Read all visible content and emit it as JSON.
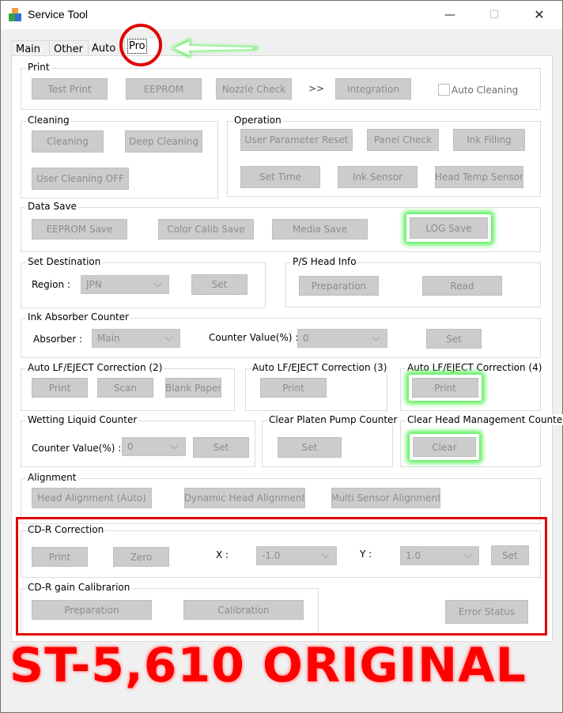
{
  "window": {
    "title": "Service Tool",
    "controls": {
      "minimize": "—",
      "maximize": "☐",
      "close": "✕"
    }
  },
  "tabs": [
    {
      "label": "Main",
      "active": false
    },
    {
      "label": "Other",
      "active": false
    },
    {
      "label": "Auto",
      "active": false
    },
    {
      "label": "Pro",
      "active": true
    }
  ],
  "print": {
    "title": "Print",
    "test_print": "Test Print",
    "eeprom": "EEPROM",
    "nozzle_check": "Nozzle Check",
    "arrow": ">>",
    "integration": "Integration",
    "auto_cleaning": "Auto Cleaning",
    "auto_cleaning_checked": false
  },
  "cleaning": {
    "title": "Cleaning",
    "cleaning": "Cleaning",
    "deep_cleaning": "Deep Cleaning",
    "user_cleaning_off": "User Cleaning OFF"
  },
  "operation": {
    "title": "Operation",
    "user_parameter_reset": "User Parameter Reset",
    "panel_check": "Panel Check",
    "ink_filling": "Ink Filling",
    "set_time": "Set Time",
    "ink_sensor": "Ink Sensor",
    "head_temp_sensor": "Head Temp Sensor"
  },
  "data_save": {
    "title": "Data Save",
    "eeprom_save": "EEPROM Save",
    "color_calib_save": "Color Calib Save",
    "media_save": "Media Save",
    "log_save": "LOG Save"
  },
  "set_destination": {
    "title": "Set Destination",
    "region_label": "Region :",
    "region_value": "JPN",
    "set": "Set"
  },
  "ps_head_info": {
    "title": "P/S Head Info",
    "preparation": "Preparation",
    "read": "Read"
  },
  "ink_absorber": {
    "title": "Ink Absorber Counter",
    "absorber_label": "Absorber :",
    "absorber_value": "Main",
    "counter_label": "Counter Value(%) :",
    "counter_value": "0",
    "set": "Set"
  },
  "auto_lf_2": {
    "title": "Auto LF/EJECT Correction (2)",
    "print": "Print",
    "scan": "Scan",
    "blank_paper": "Blank Paper"
  },
  "auto_lf_3": {
    "title": "Auto LF/EJECT Correction (3)",
    "print": "Print"
  },
  "auto_lf_4": {
    "title": "Auto LF/EJECT Correction (4)",
    "print": "Print"
  },
  "wetting": {
    "title": "Wetting Liquid Counter",
    "counter_label": "Counter Value(%) :",
    "counter_value": "0",
    "set": "Set"
  },
  "platen_pump": {
    "title": "Clear Platen Pump Counter",
    "set": "Set"
  },
  "head_mgmt": {
    "title": "Clear Head Management Counter",
    "clear": "Clear"
  },
  "alignment": {
    "title": "Alignment",
    "head_alignment_auto": "Head Alignment (Auto)",
    "dynamic_head_alignment": "Dynamic Head Alignment",
    "multi_sensor_alignment": "Multi Sensor Alignment"
  },
  "cdr_correction": {
    "title": "CD-R Correction",
    "print": "Print",
    "zero": "Zero",
    "x_label": "X :",
    "x_value": "-1.0",
    "y_label": "Y :",
    "y_value": "1.0",
    "set": "Set"
  },
  "cdr_gain": {
    "title": "CD-R gain Calibrarion",
    "preparation": "Preparation",
    "calibration": "Calibration",
    "error_status": "Error Status"
  },
  "overlay": {
    "banner": "ST-5,610 ORIGINAL",
    "highlight_color": "#e00000",
    "glow_color": "#5cf05c"
  }
}
